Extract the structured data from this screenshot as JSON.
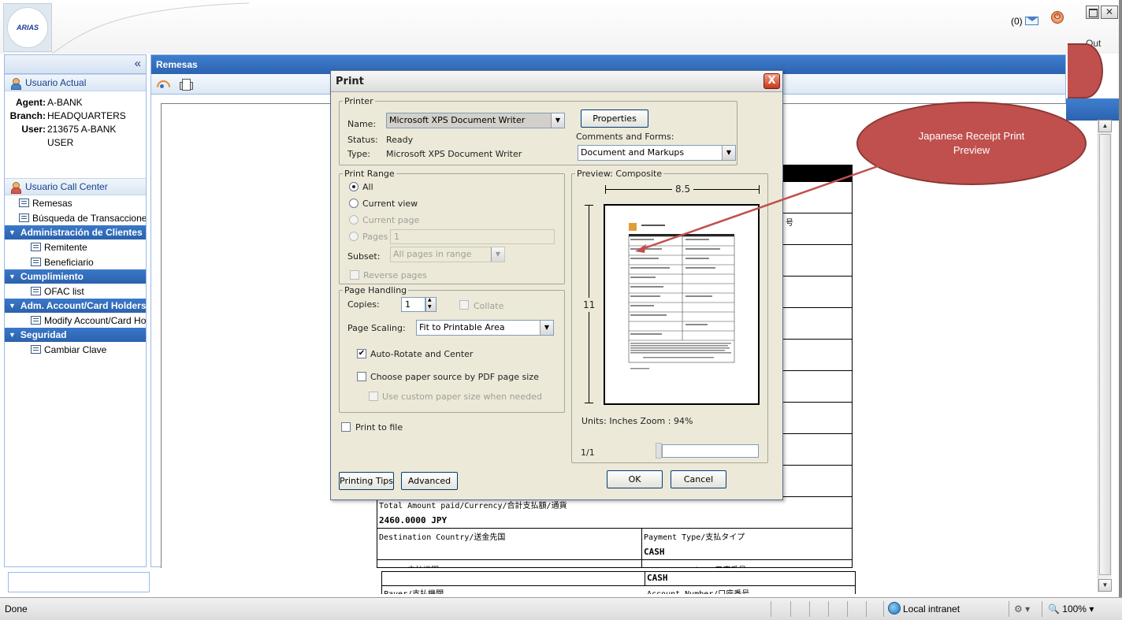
{
  "header": {
    "logo_text": "ARIAS",
    "msg_count": "(0)",
    "logout_label": "Out"
  },
  "left_panel": {
    "collapse_glyph": "«",
    "current_user_title": "Usuario Actual",
    "agent_label": "Agent:",
    "agent_value": "A-BANK",
    "branch_label": "Branch:",
    "branch_value": "HEADQUARTERS",
    "user_label": "User:",
    "user_value": "213675 A-BANK USER",
    "call_center_title": "Usuario Call Center",
    "items": [
      {
        "label": "Remesas"
      },
      {
        "label": "Búsqueda de Transacciones"
      }
    ],
    "groups": [
      {
        "title": "Administración de Clientes",
        "items": [
          "Remitente",
          "Beneficiario"
        ]
      },
      {
        "title": "Cumplimiento",
        "items": [
          "OFAC list"
        ]
      },
      {
        "title": "Adm. Account/Card Holders",
        "items": [
          "Modify Account/Card Holders"
        ]
      },
      {
        "title": "Seguridad",
        "items": [
          "Cambiar Clave"
        ]
      }
    ]
  },
  "main_panel": {
    "title": "Remesas"
  },
  "receipt": {
    "total_label": "Total Amount paid/Currency/合計支払額/通貨",
    "total_value": "2460.0000 JPY",
    "dest_label": "Destination Country/送金先国",
    "payment_type_label": "Payment Type/支払タイプ",
    "payment_type_value": "CASH",
    "payer_label": "Payer/支払機関",
    "account_label": "Account Number/口座番号",
    "bottom_value": "CASH",
    "right_mark": "号"
  },
  "print_dialog": {
    "title": "Print",
    "close_glyph": "X",
    "printer_legend": "Printer",
    "name_label": "Name:",
    "name_value": "Microsoft XPS Document Writer",
    "status_label": "Status:",
    "status_value": "Ready",
    "type_label": "Type:",
    "type_value": "Microsoft XPS Document Writer",
    "properties_button": "Properties",
    "comments_label": "Comments and Forms:",
    "comments_value": "Document and Markups",
    "range_legend": "Print Range",
    "range_all": "All",
    "range_current_view": "Current view",
    "range_current_page": "Current page",
    "range_pages": "Pages",
    "pages_value": "1",
    "subset_label": "Subset:",
    "subset_value": "All pages in range",
    "reverse_pages": "Reverse pages",
    "handling_legend": "Page Handling",
    "copies_label": "Copies:",
    "copies_value": "1",
    "collate_label": "Collate",
    "scaling_label": "Page Scaling:",
    "scaling_value": "Fit to Printable Area",
    "auto_rotate": "Auto-Rotate and Center",
    "auto_rotate_checked": true,
    "paper_source": "Choose paper source by PDF page size",
    "custom_paper": "Use custom paper size when needed",
    "print_to_file": "Print to file",
    "preview_legend": "Preview: Composite",
    "width_label": "8.5",
    "height_label": "11",
    "units_text": "Units: Inches Zoom :  94%",
    "page_indicator": "1/1",
    "printing_tips_button": "Printing Tips",
    "advanced_button": "Advanced",
    "ok_button": "OK",
    "cancel_button": "Cancel"
  },
  "callout": {
    "text": "Japanese Receipt Print Preview",
    "color": "#c0504d"
  },
  "status_bar": {
    "status": "Done",
    "zone": "Local intranet",
    "zoom": "100%"
  }
}
